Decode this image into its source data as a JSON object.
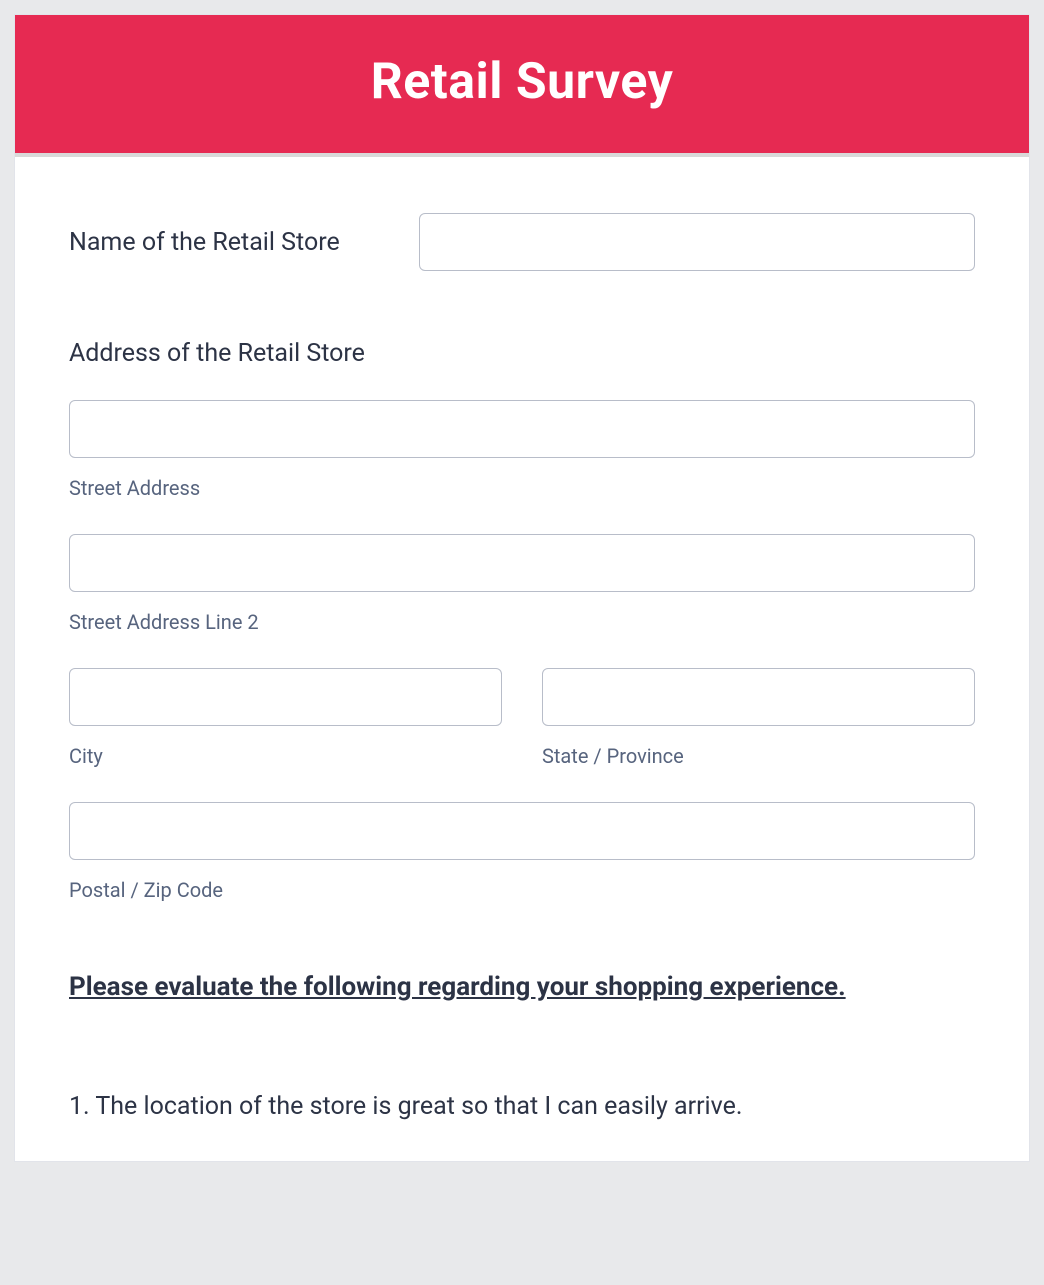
{
  "header": {
    "title": "Retail Survey"
  },
  "fields": {
    "store_name": {
      "label": "Name of the Retail Store",
      "value": ""
    },
    "store_address": {
      "label": "Address of the Retail Store",
      "street": {
        "sublabel": "Street Address",
        "value": ""
      },
      "street2": {
        "sublabel": "Street Address Line 2",
        "value": ""
      },
      "city": {
        "sublabel": "City",
        "value": ""
      },
      "state": {
        "sublabel": "State / Province",
        "value": ""
      },
      "postal": {
        "sublabel": "Postal / Zip Code",
        "value": ""
      }
    }
  },
  "evaluation": {
    "heading": "Please evaluate the following regarding your shopping experience.",
    "questions": [
      "1. The location of the store is great so that I can easily arrive."
    ]
  },
  "colors": {
    "accent": "#e62a52",
    "text": "#2c3345",
    "subtext": "#57647e",
    "border": "#b8bdc9",
    "page_bg": "#e8e9eb"
  }
}
